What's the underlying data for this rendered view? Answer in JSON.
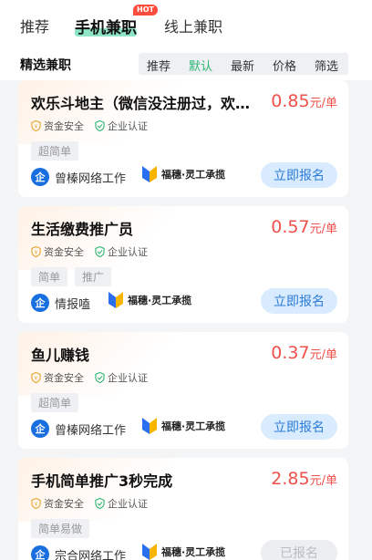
{
  "top_tabs": [
    {
      "label": "推荐"
    },
    {
      "label": "手机兼职",
      "badge": "HOT"
    },
    {
      "label": "线上兼职"
    }
  ],
  "section_title": "精选兼职",
  "sort_options": [
    "推荐",
    "默认",
    "最新",
    "价格",
    "筛选"
  ],
  "active_sort": "默认",
  "jobs": [
    {
      "title": "欢乐斗地主（微信没注册过，欢乐斗地主）",
      "price": "0.85",
      "unit": "元/单",
      "badge_safe": "资金安全",
      "badge_cert": "企业认证",
      "tags": [
        "超简单"
      ],
      "company": "曾榛网络工作",
      "partner": "福穗·灵工承揽",
      "action": "立即报名",
      "disabled": false
    },
    {
      "title": "生活缴费推广员",
      "price": "0.57",
      "unit": "元/单",
      "badge_safe": "资金安全",
      "badge_cert": "企业认证",
      "tags": [
        "简单",
        "推广"
      ],
      "company": "情报嗑",
      "partner": "福穗·灵工承揽",
      "action": "立即报名",
      "disabled": false
    },
    {
      "title": "鱼儿赚钱",
      "price": "0.37",
      "unit": "元/单",
      "badge_safe": "资金安全",
      "badge_cert": "企业认证",
      "tags": [
        "超简单"
      ],
      "company": "曾榛网络工作",
      "partner": "福穗·灵工承揽",
      "action": "立即报名",
      "disabled": false
    },
    {
      "title": "手机简单推广3秒完成",
      "price": "2.85",
      "unit": "元/单",
      "badge_safe": "资金安全",
      "badge_cert": "企业认证",
      "tags": [
        "简单易做"
      ],
      "company": "宗合网络工作",
      "partner": "福穗·灵工承揽",
      "action": "已报名",
      "disabled": true
    }
  ],
  "colors": {
    "accent_green": "#2bb673",
    "price_red": "#f0504b",
    "button_blue": "#2a7ad6",
    "hot_red": "#ff4d3d"
  }
}
